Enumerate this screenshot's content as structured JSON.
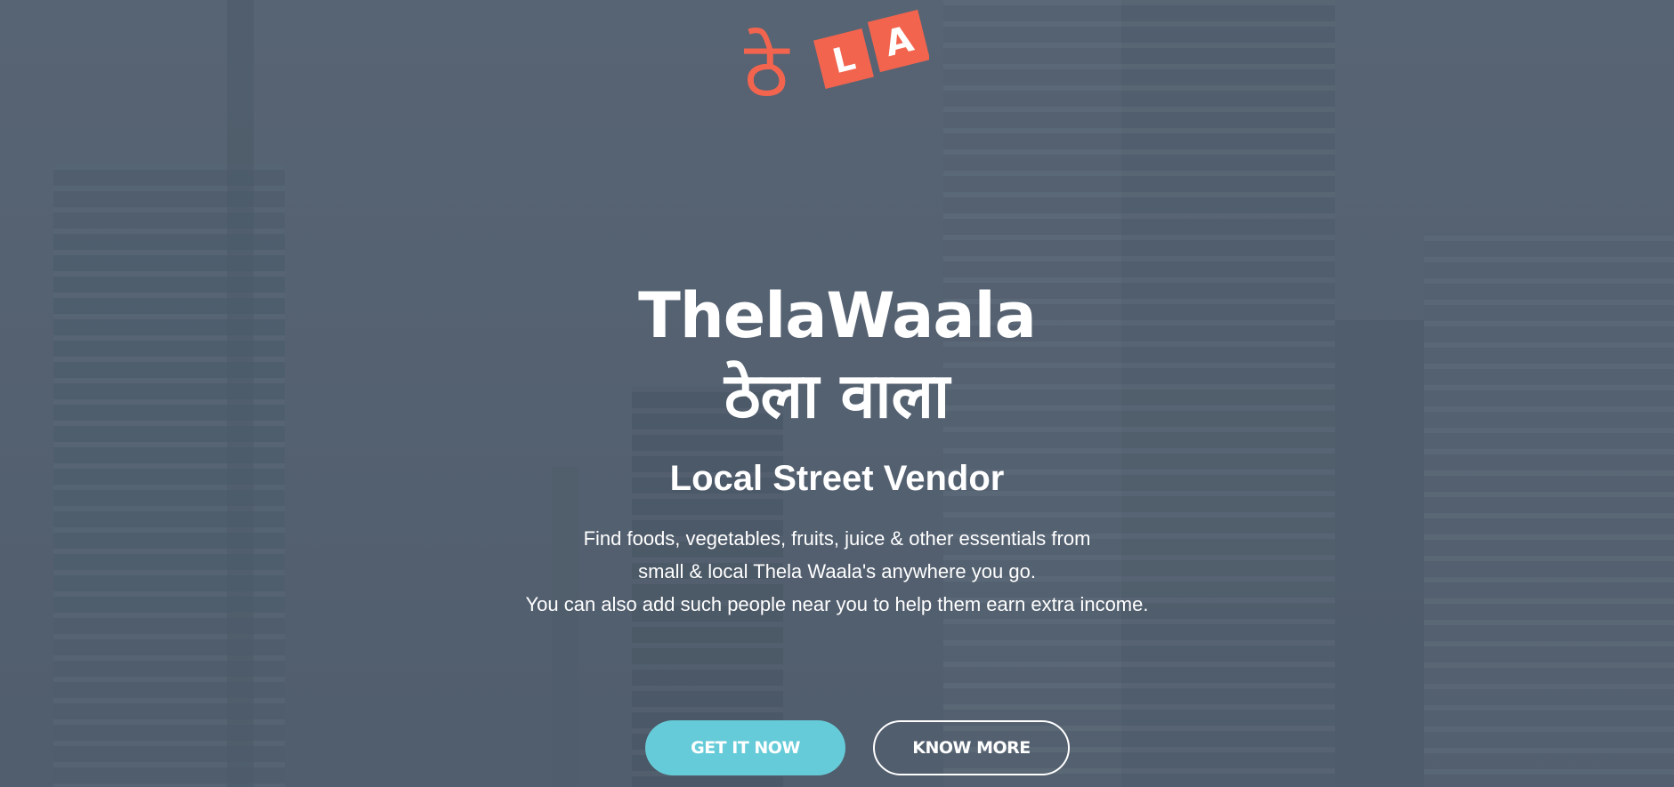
{
  "logo": {
    "glyph": "ठे",
    "letters": [
      "L",
      "A"
    ],
    "brand_color": "#f2644e"
  },
  "hero": {
    "title": "ThelaWaala",
    "title_hindi": "ठेला वाला",
    "subtitle": "Local Street Vendor",
    "description": [
      "Find foods, vegetables, fruits, juice & other essentials from",
      "small & local Thela Waala's anywhere you go.",
      "You can also add such people near you to help them earn extra income."
    ]
  },
  "actions": {
    "primary_label": "GET IT NOW",
    "secondary_label": "KNOW MORE",
    "primary_color": "#66cbd8"
  }
}
